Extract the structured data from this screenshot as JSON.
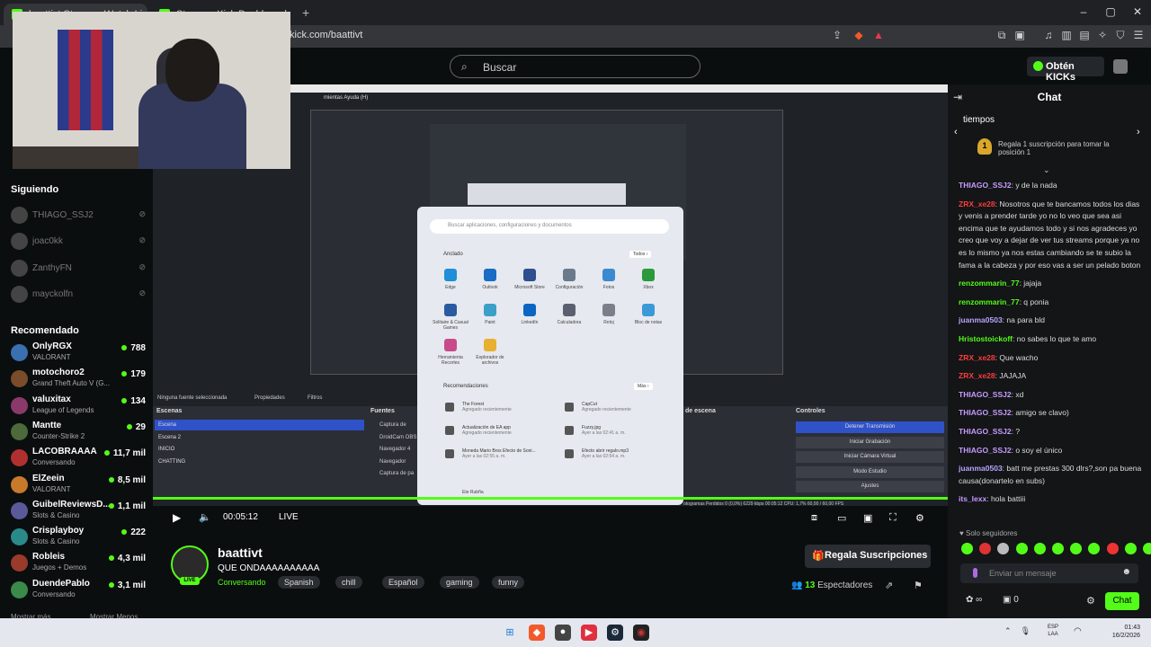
{
  "browser": {
    "tabs": [
      {
        "label": "baattivt Stream - Watch Live on..."
      },
      {
        "label": "Stream - Kick Dashboard"
      }
    ],
    "new_tab": "+",
    "url": "kick.com/baattivt",
    "window_controls": [
      "–",
      "▢",
      "✕"
    ]
  },
  "topnav": {
    "search_placeholder": "Buscar",
    "kicks_button": "Obtén KICKs"
  },
  "sidebar": {
    "following_title": "Siguiendo",
    "following": [
      {
        "name": "THIAGO_SSJ2"
      },
      {
        "name": "joac0kk"
      },
      {
        "name": "ZanthyFN"
      },
      {
        "name": "mayckolfn"
      }
    ],
    "recommended_title": "Recomendado",
    "recommended": [
      {
        "name": "OnlyRGX",
        "category": "VALORANT",
        "viewers": "788",
        "color": "#3a6fb0"
      },
      {
        "name": "motochoro2",
        "category": "Grand Theft Auto V (G...",
        "viewers": "179",
        "color": "#7a4c2a"
      },
      {
        "name": "valuxitax",
        "category": "League of Legends",
        "viewers": "134",
        "color": "#8a3a6a"
      },
      {
        "name": "Mantte",
        "category": "Counter-Strike 2",
        "viewers": "29",
        "color": "#4c6a3a"
      },
      {
        "name": "LACOBRAAAA",
        "category": "Conversando",
        "viewers": "11,7 mil",
        "color": "#b03030"
      },
      {
        "name": "ElZeein",
        "category": "VALORANT",
        "viewers": "8,5 mil",
        "color": "#c87a2a"
      },
      {
        "name": "GuibelReviewsD...",
        "category": "Slots & Casino",
        "viewers": "1,1 mil",
        "color": "#5a5a9a"
      },
      {
        "name": "Crisplayboy",
        "category": "Slots & Casino",
        "viewers": "222",
        "color": "#2a8a8a"
      },
      {
        "name": "Robleis",
        "category": "Juegos + Demos",
        "viewers": "4,3 mil",
        "color": "#9a3a2a"
      },
      {
        "name": "DuendePablo",
        "category": "Conversando",
        "viewers": "3,1 mil",
        "color": "#3a8a4a"
      }
    ],
    "show_more": "Mostrar más",
    "show_less": "Mostrar Menos"
  },
  "video": {
    "obs_menu": "mientas   Ayuda (H)",
    "scenes_header": "Escenas",
    "scenes": [
      "Escena",
      "Escena 2",
      "INICIO",
      "CHATTING"
    ],
    "sources_header": "Fuentes",
    "sources": [
      "Captura de",
      "DroidCam OBS",
      "Navegador 4",
      "Navegador",
      "Captura de pa"
    ],
    "no_source": "Ninguna fuente seleccionada",
    "properties": "Propiedades",
    "filters": "Filtros",
    "scene_transitions": "de escena",
    "controls_header": "Controles",
    "controls": [
      "Detener Transmisión",
      "Iniciar Grabación",
      "Iniciar Cámara Virtual",
      "Modo Estudio",
      "Ajustes"
    ],
    "obs_status": "otogramas Perdidos 0 (0,0%)   6229 kbps   00:05:12   CPU: 1,7%   60,00 / 60,00 FPS",
    "start_menu": {
      "search_placeholder": "Buscar aplicaciones, configuraciones y documentos",
      "pinned_title": "Anclado",
      "all_button": "Todos  ›",
      "pinned": [
        {
          "label": "Edge",
          "color": "#1f8fd8"
        },
        {
          "label": "Outlook",
          "color": "#1a6cc4"
        },
        {
          "label": "Microsoft Store",
          "color": "#2f4f8f"
        },
        {
          "label": "Configuración",
          "color": "#6a7a8a"
        },
        {
          "label": "Fotos",
          "color": "#3a8ad0"
        },
        {
          "label": "Xbox",
          "color": "#2a9a3a"
        },
        {
          "label": "Solitaire & Casual Games",
          "color": "#2a5aa0"
        },
        {
          "label": "Paint",
          "color": "#3aa0c8"
        },
        {
          "label": "LinkedIn",
          "color": "#0a66c2"
        },
        {
          "label": "Calculadora",
          "color": "#5a6070"
        },
        {
          "label": "Reloj",
          "color": "#7a7f8a"
        },
        {
          "label": "Bloc de notas",
          "color": "#3a9ad8"
        },
        {
          "label": "Herramienta Recortes",
          "color": "#c84a8a"
        },
        {
          "label": "Explorador de archivos",
          "color": "#e8b030"
        }
      ],
      "recommended_title": "Recomendaciones",
      "more_button": "Más  ›",
      "recommended": [
        {
          "title": "The Forest",
          "sub": "Agregado recientemente"
        },
        {
          "title": "CapCut",
          "sub": "Agregado recientemente"
        },
        {
          "title": "Actualización de EA app",
          "sub": "Agregado recientemente"
        },
        {
          "title": "Fuzzy.jpg",
          "sub": "Ayer a las 02:41 a. m."
        },
        {
          "title": "Moneda Mario Bros Efecto de Soni...",
          "sub": "Ayer a las 02:55 a. m."
        },
        {
          "title": "Efecto abrir regalo.mp3",
          "sub": "Ayer a las 02:54 a. m."
        }
      ],
      "user": "Ete Rubña"
    }
  },
  "player": {
    "time": "00:05:12",
    "live": "LIVE"
  },
  "stream": {
    "name": "baattivt",
    "title": "QUE ONDAAAAAAAAAA",
    "live_badge": "LIVE",
    "category": "Conversando",
    "tags": [
      "Spanish",
      "chill",
      "Español",
      "gaming",
      "funny"
    ],
    "gift_button": "Regala Suscripciones",
    "viewers": "13",
    "viewers_label": "Espectadores"
  },
  "chat": {
    "title": "Chat",
    "pinned_title": "tiempos",
    "pinned_rank": "1",
    "pinned_message": "Regala 1 suscripción para tomar la posición 1",
    "messages": [
      {
        "user": "THIAGO_SSJ2",
        "text": "y de la nada",
        "color": "#c69cff"
      },
      {
        "user": "ZRX_xe28",
        "text": "Nosotros que te bancamos todos los dias y venis a prender tarde yo no lo veo que sea asi encima que te ayudamos todo y si nos agradeces yo creo que voy a dejar de ver tus streams porque ya no es lo mismo ya nos estas cambiando se te subio la fama a la cabeza y por eso vas a ser un pelado boton",
        "color": "#ff3b3b"
      },
      {
        "user": "renzommarin_77",
        "text": "jajaja",
        "color": "#53fc18"
      },
      {
        "user": "renzommarin_77",
        "text": "q ponia",
        "color": "#53fc18"
      },
      {
        "user": "juanma0503",
        "text": "na para bld",
        "color": "#b9a4ff"
      },
      {
        "user": "Hristostoickoff",
        "text": "no sabes lo que te amo",
        "color": "#53fc18"
      },
      {
        "user": "ZRX_xe28",
        "text": "Que wacho",
        "color": "#ff3b3b"
      },
      {
        "user": "ZRX_xe28",
        "text": "JAJAJA",
        "color": "#ff3b3b"
      },
      {
        "user": "THIAGO_SSJ2",
        "text": "xd",
        "color": "#c69cff"
      },
      {
        "user": "THIAGO_SSJ2",
        "text": "amigo se clavo)",
        "color": "#c69cff"
      },
      {
        "user": "THIAGO_SSJ2",
        "text": "?",
        "color": "#c69cff"
      },
      {
        "user": "THIAGO_SSJ2",
        "text": "o soy el único",
        "color": "#c69cff"
      },
      {
        "user": "juanma0503",
        "text": "batt me prestas 300 dlrs?,son pa buena causa(donartelo en subs)",
        "color": "#b9a4ff"
      },
      {
        "user": "its_lexx",
        "text": "hola battiii",
        "color": "#c69cff"
      }
    ],
    "followers_only": "Solo seguidores",
    "input_placeholder": "Enviar un mensaje",
    "kicks_count": "",
    "zero": "0",
    "send_button": "Chat"
  },
  "taskbar": {
    "lang": "ESP",
    "lang2": "LAA",
    "time": "01:43",
    "date": "16/2/2026"
  }
}
